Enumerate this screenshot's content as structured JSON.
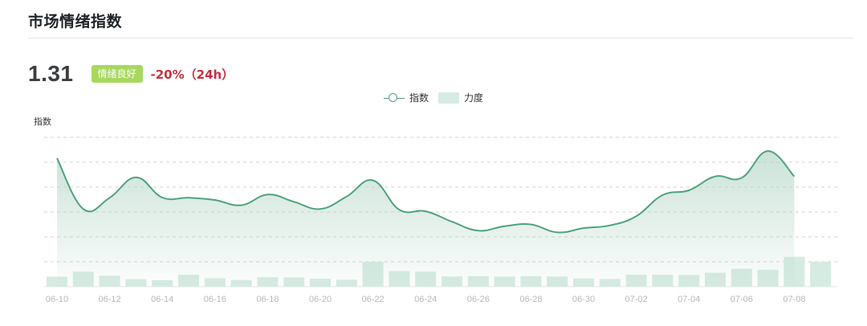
{
  "header": {
    "title": "市场情绪指数"
  },
  "summary": {
    "value": "1.31",
    "status_badge": "情绪良好",
    "change": "-20%（24h）"
  },
  "colors": {
    "line": "#4fa27f",
    "area": "#b9d9ca",
    "bar": "#d6ebe2",
    "badge": "#a8d85d",
    "change_negative": "#c8303f",
    "grid": "#d0d0d0",
    "tick_text": "#b8b8b8"
  },
  "chart_data": {
    "type": "line",
    "title": "",
    "ylabel": "指数",
    "xlabel": "",
    "grid": true,
    "legend_position": "top-center",
    "legend": [
      "指数",
      "力度"
    ],
    "x_tick_labels": [
      "06-10",
      "06-12",
      "06-14",
      "06-16",
      "06-18",
      "06-20",
      "06-22",
      "06-24",
      "06-26",
      "06-28",
      "06-30",
      "07-02",
      "07-04",
      "07-06",
      "07-08"
    ],
    "ylim": [
      0,
      6
    ],
    "categories": [
      "06-10",
      "06-11",
      "06-12",
      "06-13",
      "06-14",
      "06-15",
      "06-16",
      "06-17",
      "06-18",
      "06-19",
      "06-20",
      "06-21",
      "06-22",
      "06-23",
      "06-24",
      "06-25",
      "06-26",
      "06-27",
      "06-28",
      "06-29",
      "06-30",
      "07-01",
      "07-02",
      "07-03",
      "07-04",
      "07-05",
      "07-06",
      "07-07",
      "07-08",
      "07-09"
    ],
    "series": [
      {
        "name": "指数",
        "type": "line",
        "values": [
          5.16,
          3.12,
          3.57,
          4.39,
          3.58,
          3.57,
          3.48,
          3.27,
          3.7,
          3.41,
          3.12,
          3.62,
          4.27,
          3.09,
          3.03,
          2.61,
          2.25,
          2.43,
          2.5,
          2.18,
          2.35,
          2.46,
          2.83,
          3.68,
          3.87,
          4.43,
          4.37,
          5.45,
          4.43
        ]
      },
      {
        "name": "力度",
        "type": "bar",
        "values": [
          0.4,
          0.6,
          0.44,
          0.3,
          0.26,
          0.48,
          0.34,
          0.27,
          0.38,
          0.37,
          0.32,
          0.28,
          1.0,
          0.63,
          0.6,
          0.41,
          0.42,
          0.41,
          0.42,
          0.41,
          0.33,
          0.31,
          0.48,
          0.48,
          0.47,
          0.56,
          0.72,
          0.68,
          1.2,
          1.0
        ]
      }
    ]
  }
}
